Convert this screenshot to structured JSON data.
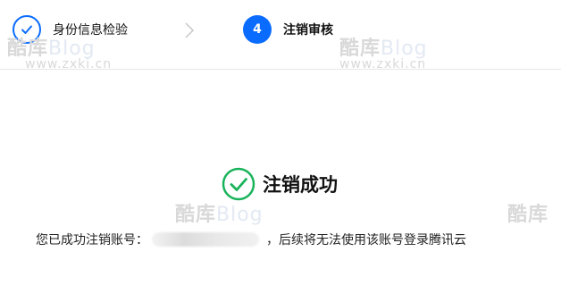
{
  "stepper": {
    "steps": [
      {
        "label": "身份信息检验",
        "state": "done"
      },
      {
        "number": "4",
        "label": "注销审核",
        "state": "active"
      }
    ]
  },
  "result": {
    "title": "注销成功",
    "desc_prefix": "您已成功注销账号：",
    "desc_suffix": "，后续将无法使用该账号登录腾讯云"
  },
  "watermark": {
    "brand_cn": "酷库",
    "brand_en": "Blog",
    "url": "www.zxki.cn"
  },
  "colors": {
    "accent": "#0a6cff",
    "success": "#19b35b",
    "divider": "#e6e6e6"
  }
}
